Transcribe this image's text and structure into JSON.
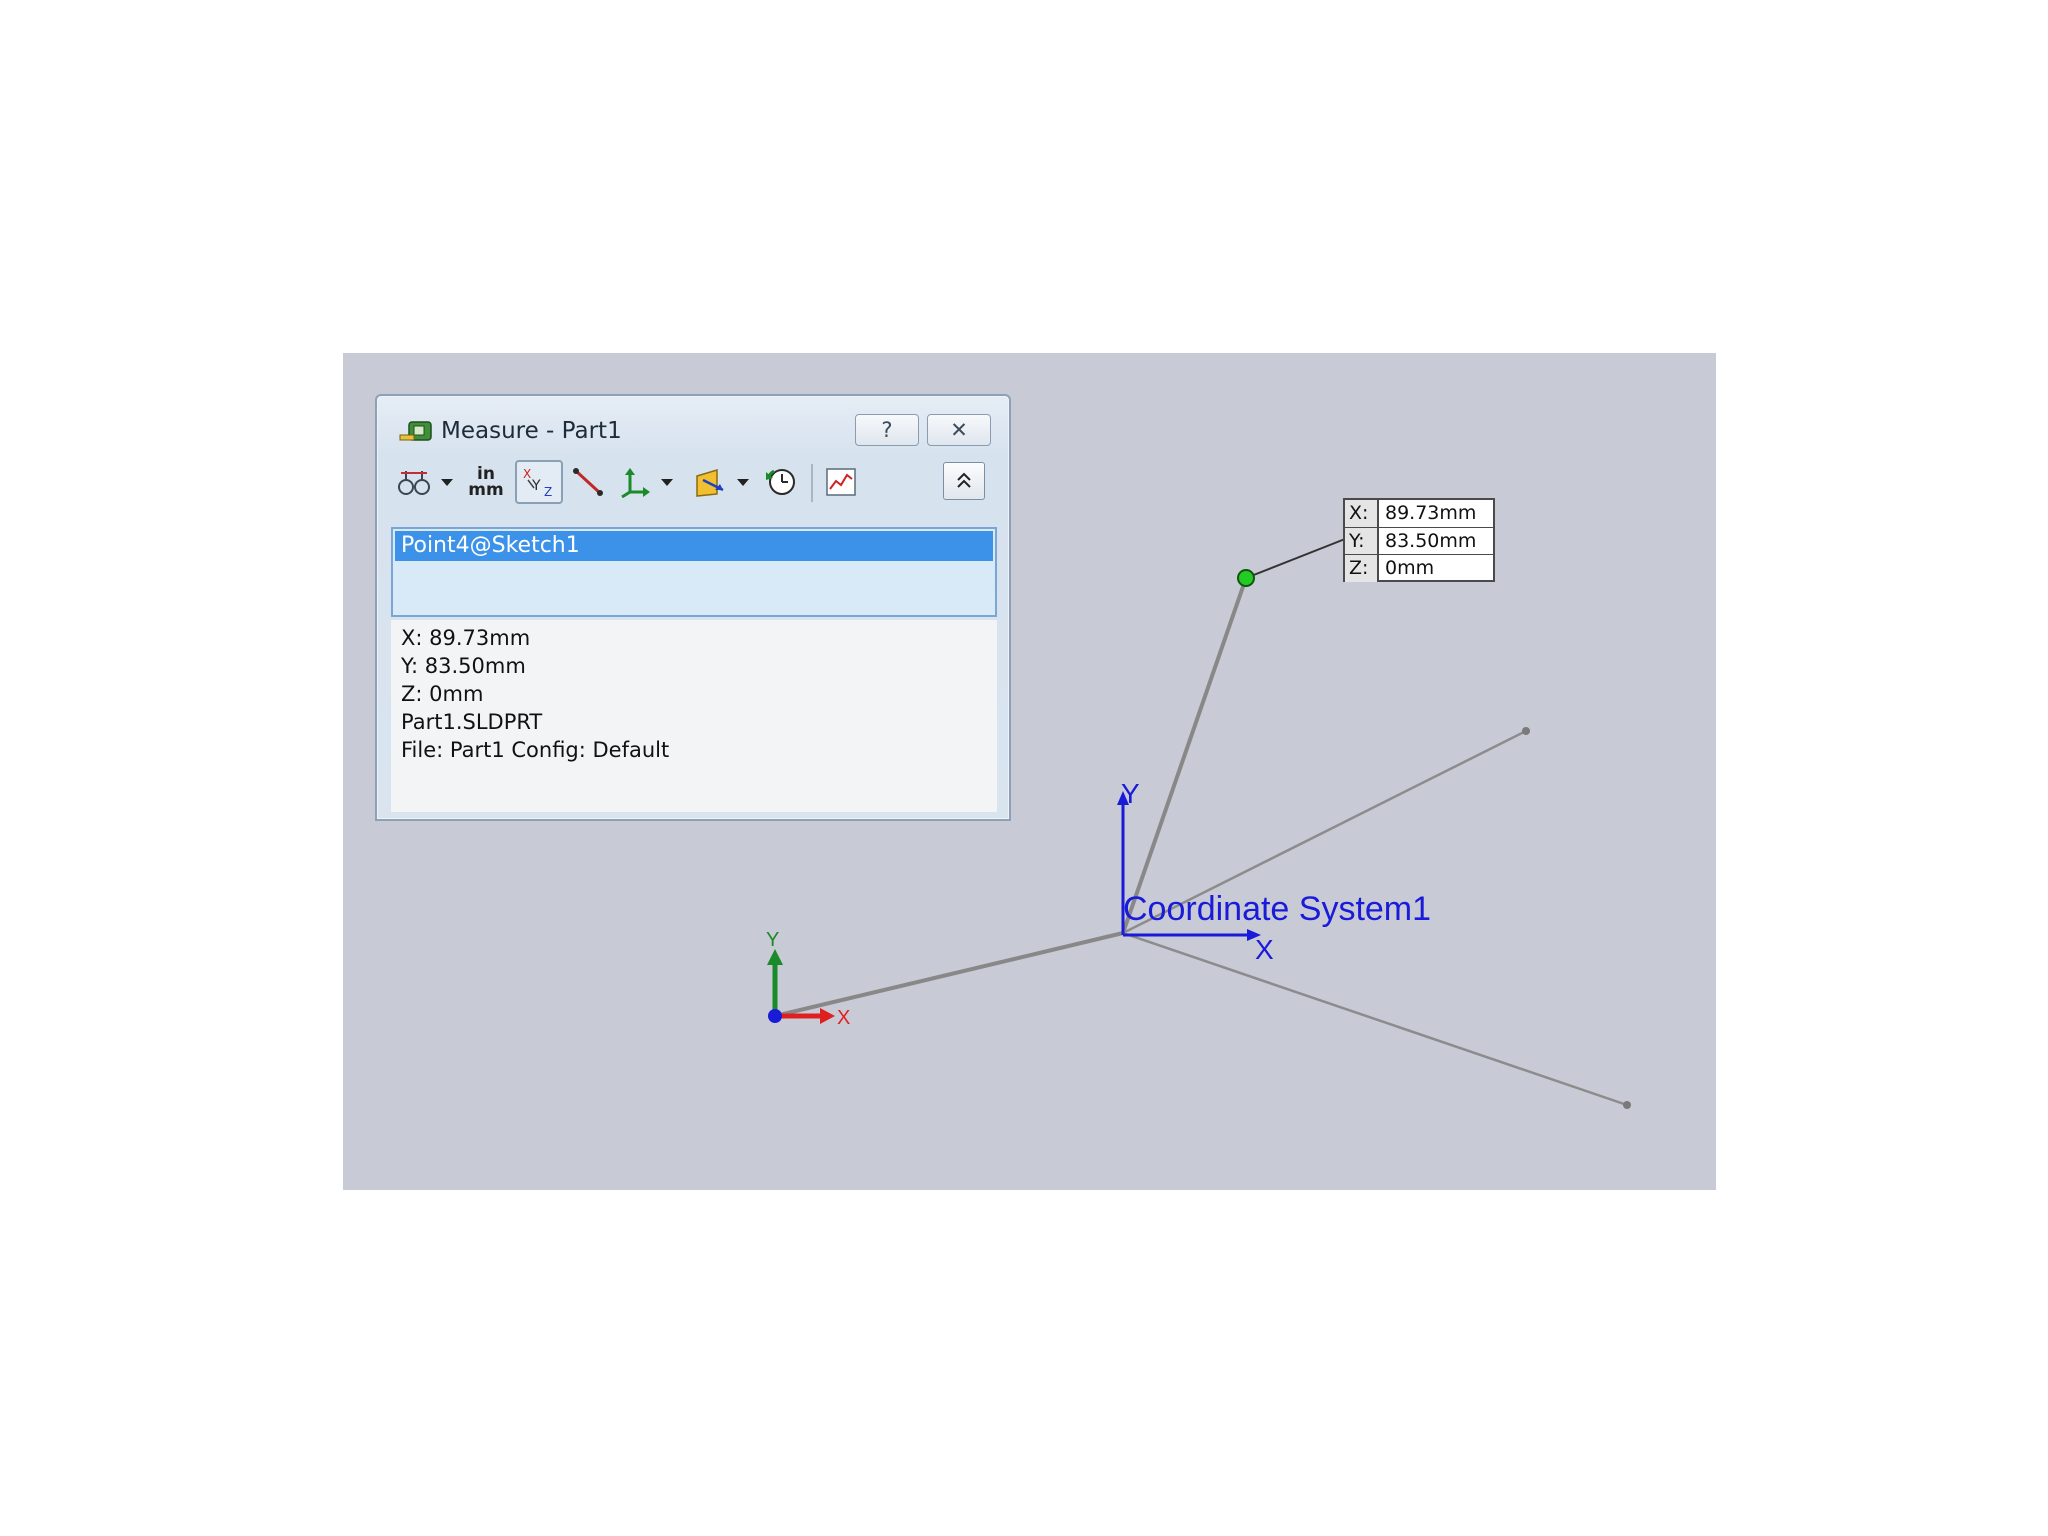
{
  "dialog": {
    "title": "Measure - Part1",
    "help_label": "?",
    "close_label": "✕",
    "selected_item": "Point4@Sketch1",
    "results": [
      "X: 89.73mm",
      "Y: 83.50mm",
      "Z: 0mm",
      "Part1.SLDPRT",
      "File: Part1 Config: Default"
    ],
    "toolbar": {
      "units_top": "in",
      "units_bottom": "mm"
    }
  },
  "callout": {
    "x_label": "X:",
    "x_value": "89.73mm",
    "y_label": "Y:",
    "y_value": "83.50mm",
    "z_label": "Z:",
    "z_value": "0mm"
  },
  "scene": {
    "coordinate_system_label": "Coordinate System1",
    "origin_x_label": "X",
    "origin_y_label": "Y",
    "cs_x_label": "X",
    "cs_y_label": "Y"
  },
  "colors": {
    "viewport_bg": "#c8cad5",
    "sketch_line": "#888888",
    "selected_point": "#22cc22",
    "cs_blue": "#1a1ad9",
    "axis_red": "#e02020",
    "axis_green": "#1b8a2a",
    "selection_blue": "#3b92e8"
  }
}
